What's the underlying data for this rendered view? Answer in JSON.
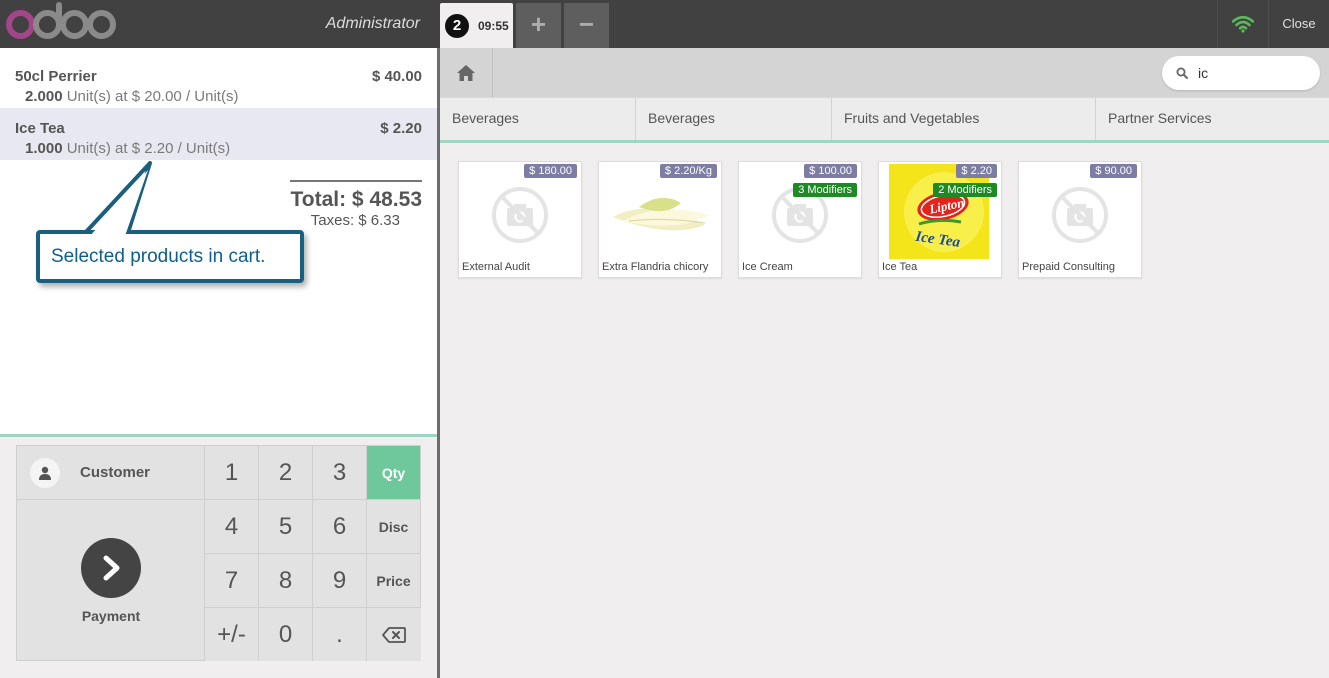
{
  "header": {
    "user": "Administrator",
    "order_number": "2",
    "order_time": "09:55",
    "add_order": "+",
    "remove_order": "−",
    "close_label": "Close"
  },
  "order": {
    "lines": [
      {
        "name": "50cl Perrier",
        "price": "$ 40.00",
        "qty": "2.000",
        "detail": "Unit(s) at $ 20.00 / Unit(s)"
      },
      {
        "name": "Ice Tea",
        "price": "$ 2.20",
        "qty": "1.000",
        "detail": "Unit(s) at $ 2.20 / Unit(s)"
      }
    ],
    "total": "Total: $ 48.53",
    "taxes": "Taxes: $ 6.33"
  },
  "callout": {
    "text": "Selected products in cart."
  },
  "pad": {
    "customer_label": "Customer",
    "payment_label": "Payment",
    "keys": [
      "1",
      "2",
      "3",
      "4",
      "5",
      "6",
      "7",
      "8",
      "9",
      "+/-",
      "0",
      "."
    ],
    "modes": [
      "Qty",
      "Disc",
      "Price"
    ],
    "active_mode": "Qty"
  },
  "search": {
    "value": "ic"
  },
  "categories": [
    "Beverages",
    "Beverages",
    "Fruits and Vegetables",
    "Partner Services"
  ],
  "products": [
    {
      "name": "External Audit",
      "price": "$ 180.00",
      "modifiers": "",
      "image": "placeholder"
    },
    {
      "name": "Extra Flandria chicory",
      "price": "$ 2.20/Kg",
      "modifiers": "",
      "image": "chicory"
    },
    {
      "name": "Ice Cream",
      "price": "$ 100.00",
      "modifiers": "3 Modifiers",
      "image": "placeholder"
    },
    {
      "name": "Ice Tea",
      "price": "$ 2.20",
      "modifiers": "2 Modifiers",
      "image": "lipton"
    },
    {
      "name": "Prepaid Consulting",
      "price": "$ 90.00",
      "modifiers": "",
      "image": "placeholder"
    }
  ],
  "lipton_logo": {
    "brand": "Lipton",
    "product": "Ice Tea"
  },
  "colors": {
    "header": "#414141",
    "accent": "#6ec89b",
    "price_tag": "#7d7da4",
    "modifier_tag": "#1d8a25",
    "callout_border": "#1b5f7f"
  },
  "icons": {
    "home": "home-icon",
    "search": "search-icon",
    "wifi": "wifi-icon",
    "customer": "user-icon",
    "payment": "chevron-right-icon",
    "backspace": "backspace-icon"
  }
}
